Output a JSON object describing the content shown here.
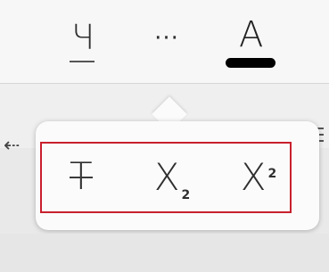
{
  "toolbar": {
    "underline": {
      "glyph": "Ч",
      "icon": "underline-icon"
    },
    "more": {
      "glyph": "···",
      "icon": "more-options-icon"
    },
    "font_color": {
      "glyph": "A",
      "color": "#000000",
      "icon": "font-color-icon"
    }
  },
  "flyout": {
    "items": [
      {
        "icon": "strikethrough-icon",
        "glyph": "T"
      },
      {
        "icon": "subscript-icon",
        "glyph": "X",
        "small": "2"
      },
      {
        "icon": "superscript-icon",
        "glyph": "X",
        "small": "2"
      }
    ],
    "highlight_color": "#c8202d"
  }
}
